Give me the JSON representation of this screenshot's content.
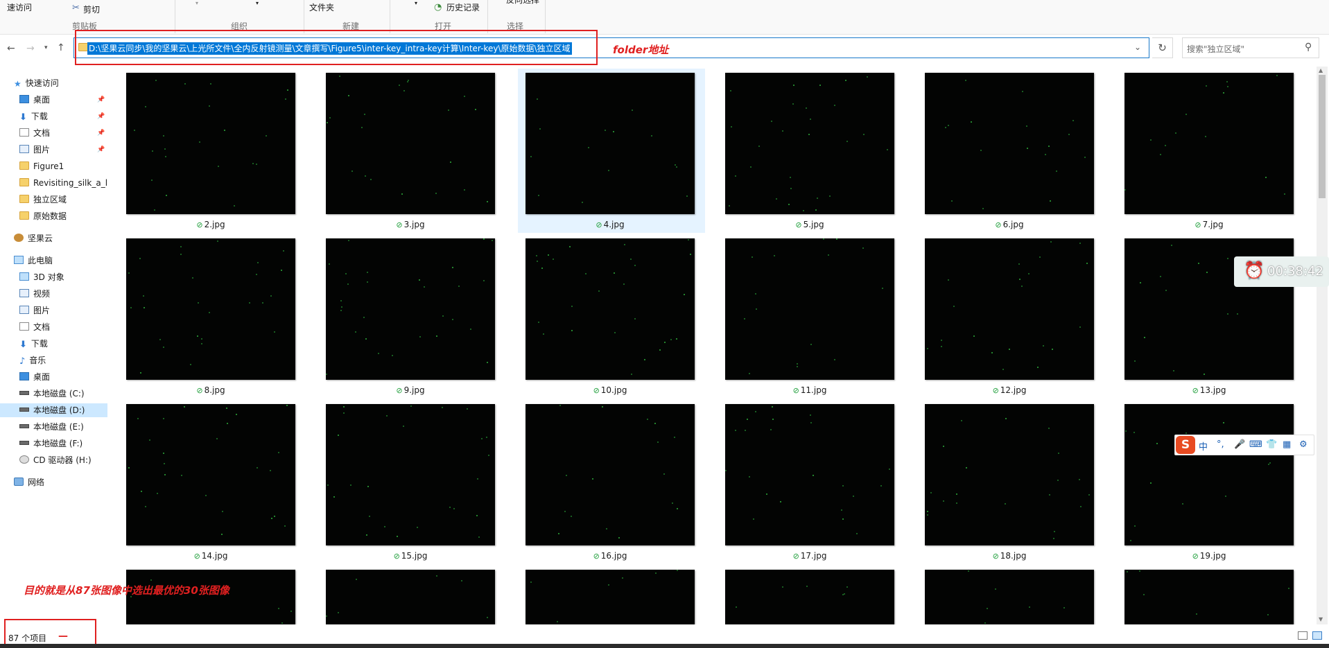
{
  "ribbon": {
    "quick_access": "速访问",
    "cut": "剪切",
    "folder": "文件夹",
    "history": "历史记录",
    "reverse_select": "反向选择",
    "groups": [
      "剪贴板",
      "组织",
      "新建",
      "打开",
      "选择"
    ]
  },
  "address": {
    "path": "D:\\坚果云同步\\我的坚果云\\上光所文件\\全内反射镜测量\\文章撰写\\Figure5\\inter-key_intra-key计算\\Inter-key\\原始数据\\独立区域",
    "annotation": "folder地址"
  },
  "search": {
    "placeholder": "搜索\"独立区域\""
  },
  "nav": {
    "quick_access": "快速访问",
    "quick_items": [
      "桌面",
      "下载",
      "文档",
      "图片",
      "Figure1",
      "Revisiting_silk_a_le",
      "独立区域",
      "原始数据"
    ],
    "jianguoyun": "坚果云",
    "this_pc": "此电脑",
    "pc_items": [
      "3D 对象",
      "视频",
      "图片",
      "文档",
      "下载",
      "音乐",
      "桌面",
      "本地磁盘 (C:)",
      "本地磁盘 (D:)",
      "本地磁盘 (E:)",
      "本地磁盘 (F:)",
      "CD 驱动器 (H:)"
    ],
    "network": "网络"
  },
  "files": [
    "2.jpg",
    "3.jpg",
    "4.jpg",
    "5.jpg",
    "6.jpg",
    "7.jpg",
    "8.jpg",
    "9.jpg",
    "10.jpg",
    "11.jpg",
    "12.jpg",
    "13.jpg",
    "14.jpg",
    "15.jpg",
    "16.jpg",
    "17.jpg",
    "18.jpg",
    "19.jpg"
  ],
  "timer": "00:38:42",
  "ime": {
    "lang": "中",
    "punct": "°,"
  },
  "annotation_goal": "目的就是从87张图像中选出最优的30张图像",
  "status": {
    "count": "87 个项目",
    "dash": "—"
  },
  "colors": {
    "selection": "#0078d7",
    "annotation": "#e02020",
    "thumb_bg": "#030403"
  }
}
